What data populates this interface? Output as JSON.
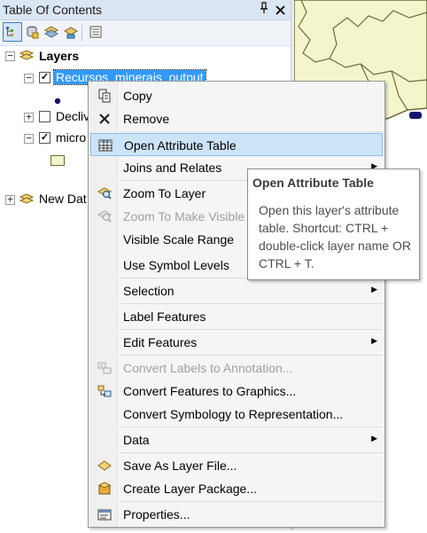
{
  "toc": {
    "title": "Table Of Contents",
    "pin_glyph": "↑",
    "close_glyph": "✕",
    "toolbar": [
      "list-by-drawing-order-icon",
      "list-by-source-icon",
      "list-by-visibility-icon",
      "list-by-selection-icon",
      "options-icon"
    ],
    "tree": {
      "root_label": "Layers",
      "items": [
        {
          "label": "Recursos_minerais_output",
          "checked": true,
          "selected": true,
          "expanded": true
        },
        {
          "label": "Decliv",
          "checked": false,
          "expanded": false
        },
        {
          "label": "micro",
          "checked": true,
          "expanded": true
        }
      ],
      "new_data_frame": "New Dat"
    }
  },
  "context_menu": {
    "items": [
      {
        "label": "Copy",
        "icon": "copy-icon"
      },
      {
        "label": "Remove",
        "icon": "remove-icon"
      },
      {
        "label": "Open Attribute Table",
        "icon": "table-icon",
        "highlighted": true
      },
      {
        "label": "Joins and Relates",
        "submenu": true
      },
      {
        "label": "Zoom To Layer",
        "icon": "zoom-to-layer-icon"
      },
      {
        "label": "Zoom To Make Visible",
        "icon": "zoom-to-visible-icon",
        "disabled": true
      },
      {
        "label": "Visible Scale Range",
        "submenu": true
      },
      {
        "label": "Use Symbol Levels"
      },
      {
        "label": "Selection",
        "submenu": true
      },
      {
        "label": "Label Features"
      },
      {
        "label": "Edit Features",
        "submenu": true
      },
      {
        "label": "Convert Labels to Annotation...",
        "icon": "convert-labels-icon",
        "disabled": true
      },
      {
        "label": "Convert Features to Graphics...",
        "icon": "convert-graphics-icon"
      },
      {
        "label": "Convert Symbology to Representation..."
      },
      {
        "label": "Data",
        "submenu": true
      },
      {
        "label": "Save As Layer File...",
        "icon": "save-layer-icon"
      },
      {
        "label": "Create Layer Package...",
        "icon": "layer-package-icon"
      },
      {
        "label": "Properties...",
        "icon": "properties-icon"
      }
    ]
  },
  "tooltip": {
    "title": "Open Attribute Table",
    "body": "Open this layer's attribute table. Shortcut: CTRL + double-click layer name OR CTRL + T."
  },
  "colors": {
    "selection": "#3399ff",
    "menu_highlight": "#cce4f7",
    "map_fill": "#f5f5cc"
  }
}
